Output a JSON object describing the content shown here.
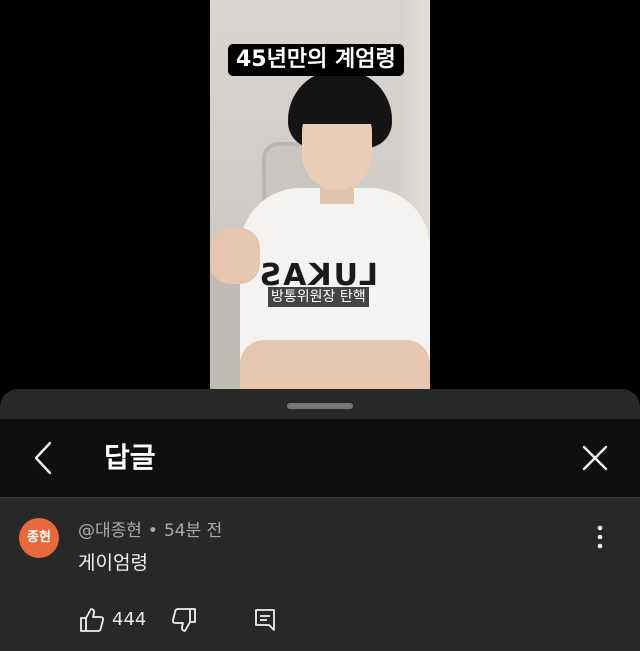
{
  "video": {
    "title_overlay": "45년만의 계엄령",
    "subtitle_overlay": "방통위원장 탄핵",
    "shirt_print": "LUKAS"
  },
  "replies_panel": {
    "title": "답글",
    "back_icon": "chevron-left-icon",
    "close_icon": "close-icon"
  },
  "comment": {
    "avatar_text": "종현",
    "avatar_color": "#e86a3c",
    "author": "@대종현",
    "separator": "•",
    "time": "54분 전",
    "text": "게이엄령",
    "like_count": "444",
    "icons": [
      "thumbs-up-icon",
      "thumbs-down-icon",
      "reply-icon",
      "more-vertical-icon"
    ]
  }
}
